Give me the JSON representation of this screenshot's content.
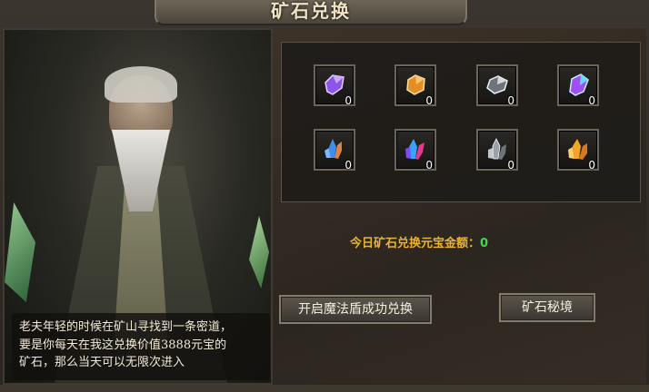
{
  "title": "矿石兑换",
  "dialog": {
    "line1": "老夫年轻的时候在矿山寻找到一条密道，",
    "line2": "要是你每天在我这兑换价值3888元宝的",
    "line3": "矿石，那么当天可以无限次进入"
  },
  "items": [
    {
      "icon": "purple-ore-icon",
      "count": "0",
      "color": "#9a5cf0"
    },
    {
      "icon": "amber-ore-icon",
      "count": "0",
      "color": "#e8a238"
    },
    {
      "icon": "silver-ore-icon",
      "count": "0",
      "color": "#c7ccd2"
    },
    {
      "icon": "violet-crystal-ore-icon",
      "count": "0",
      "color": "#b56fff"
    },
    {
      "icon": "blue-crystal-cluster-icon",
      "count": "0",
      "color": "#4aa1ff"
    },
    {
      "icon": "rainbow-crystal-cluster-icon",
      "count": "0",
      "color": "#e2498d"
    },
    {
      "icon": "gray-crystal-cluster-icon",
      "count": "0",
      "color": "#9aa0a8"
    },
    {
      "icon": "gold-crystal-cluster-icon",
      "count": "0",
      "color": "#f0a62a"
    }
  ],
  "summary": {
    "label": "今日矿石兑换元宝金额：",
    "value": "0"
  },
  "buttons": {
    "shield": "开启魔法盾成功兑换",
    "secret": "矿石秘境"
  }
}
